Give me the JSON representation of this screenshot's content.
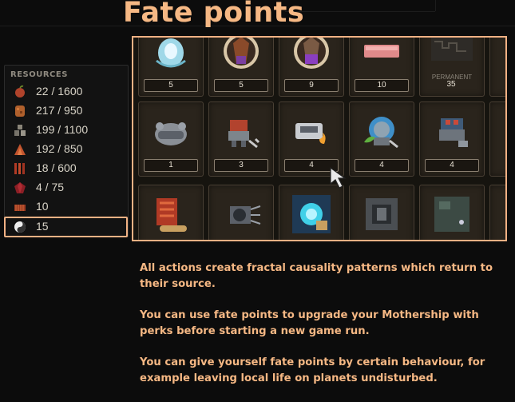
{
  "title": "Fate points",
  "resources": {
    "header": "RESOURCES",
    "items": [
      {
        "icon": "apple-icon",
        "value": "22 / 1600"
      },
      {
        "icon": "ore-icon",
        "value": "217 / 950"
      },
      {
        "icon": "crates-icon",
        "value": "199 / 1100"
      },
      {
        "icon": "crystals-icon",
        "value": "192 / 850"
      },
      {
        "icon": "fuel-rods-icon",
        "value": "18 / 600"
      },
      {
        "icon": "gem-icon",
        "value": "4 / 75"
      },
      {
        "icon": "bricks-icon",
        "value": "10"
      },
      {
        "icon": "yin-yang-icon",
        "value": "15",
        "highlighted": true
      }
    ]
  },
  "perks": {
    "rows": [
      [
        {
          "icon": "frost-creature-icon",
          "count": "5"
        },
        {
          "icon": "alien-priest-icon",
          "count": "5"
        },
        {
          "icon": "alien-priest-icon",
          "count": "9"
        },
        {
          "icon": "pink-slab-icon",
          "count": "10"
        },
        {
          "icon": "circuit-icon",
          "count": "35",
          "label": "PERMANENT"
        }
      ],
      [
        {
          "icon": "robot-pod-icon",
          "count": "1"
        },
        {
          "icon": "repair-robot-icon",
          "count": "3"
        },
        {
          "icon": "fire-vehicle-icon",
          "count": "4"
        },
        {
          "icon": "leaf-robot-icon",
          "count": "4"
        },
        {
          "icon": "turret-robot-icon",
          "count": "4"
        }
      ],
      [
        {
          "icon": "fuel-engine-icon",
          "count": ""
        },
        {
          "icon": "drill-icon",
          "count": ""
        },
        {
          "icon": "portal-device-icon",
          "count": ""
        },
        {
          "icon": "hatch-icon",
          "count": ""
        },
        {
          "icon": "hull-plate-icon",
          "count": ""
        }
      ]
    ]
  },
  "description": [
    "All actions create fractal causality patterns which return to their source.",
    "You can use fate points to upgrade your Mothership with perks before starting a new game run.",
    "You can give yourself fate points by certain behaviour, for example leaving local life on planets undisturbed."
  ],
  "colors": {
    "accent": "#f6b884",
    "frame": "#f1b184",
    "background": "#0c0c0c"
  }
}
